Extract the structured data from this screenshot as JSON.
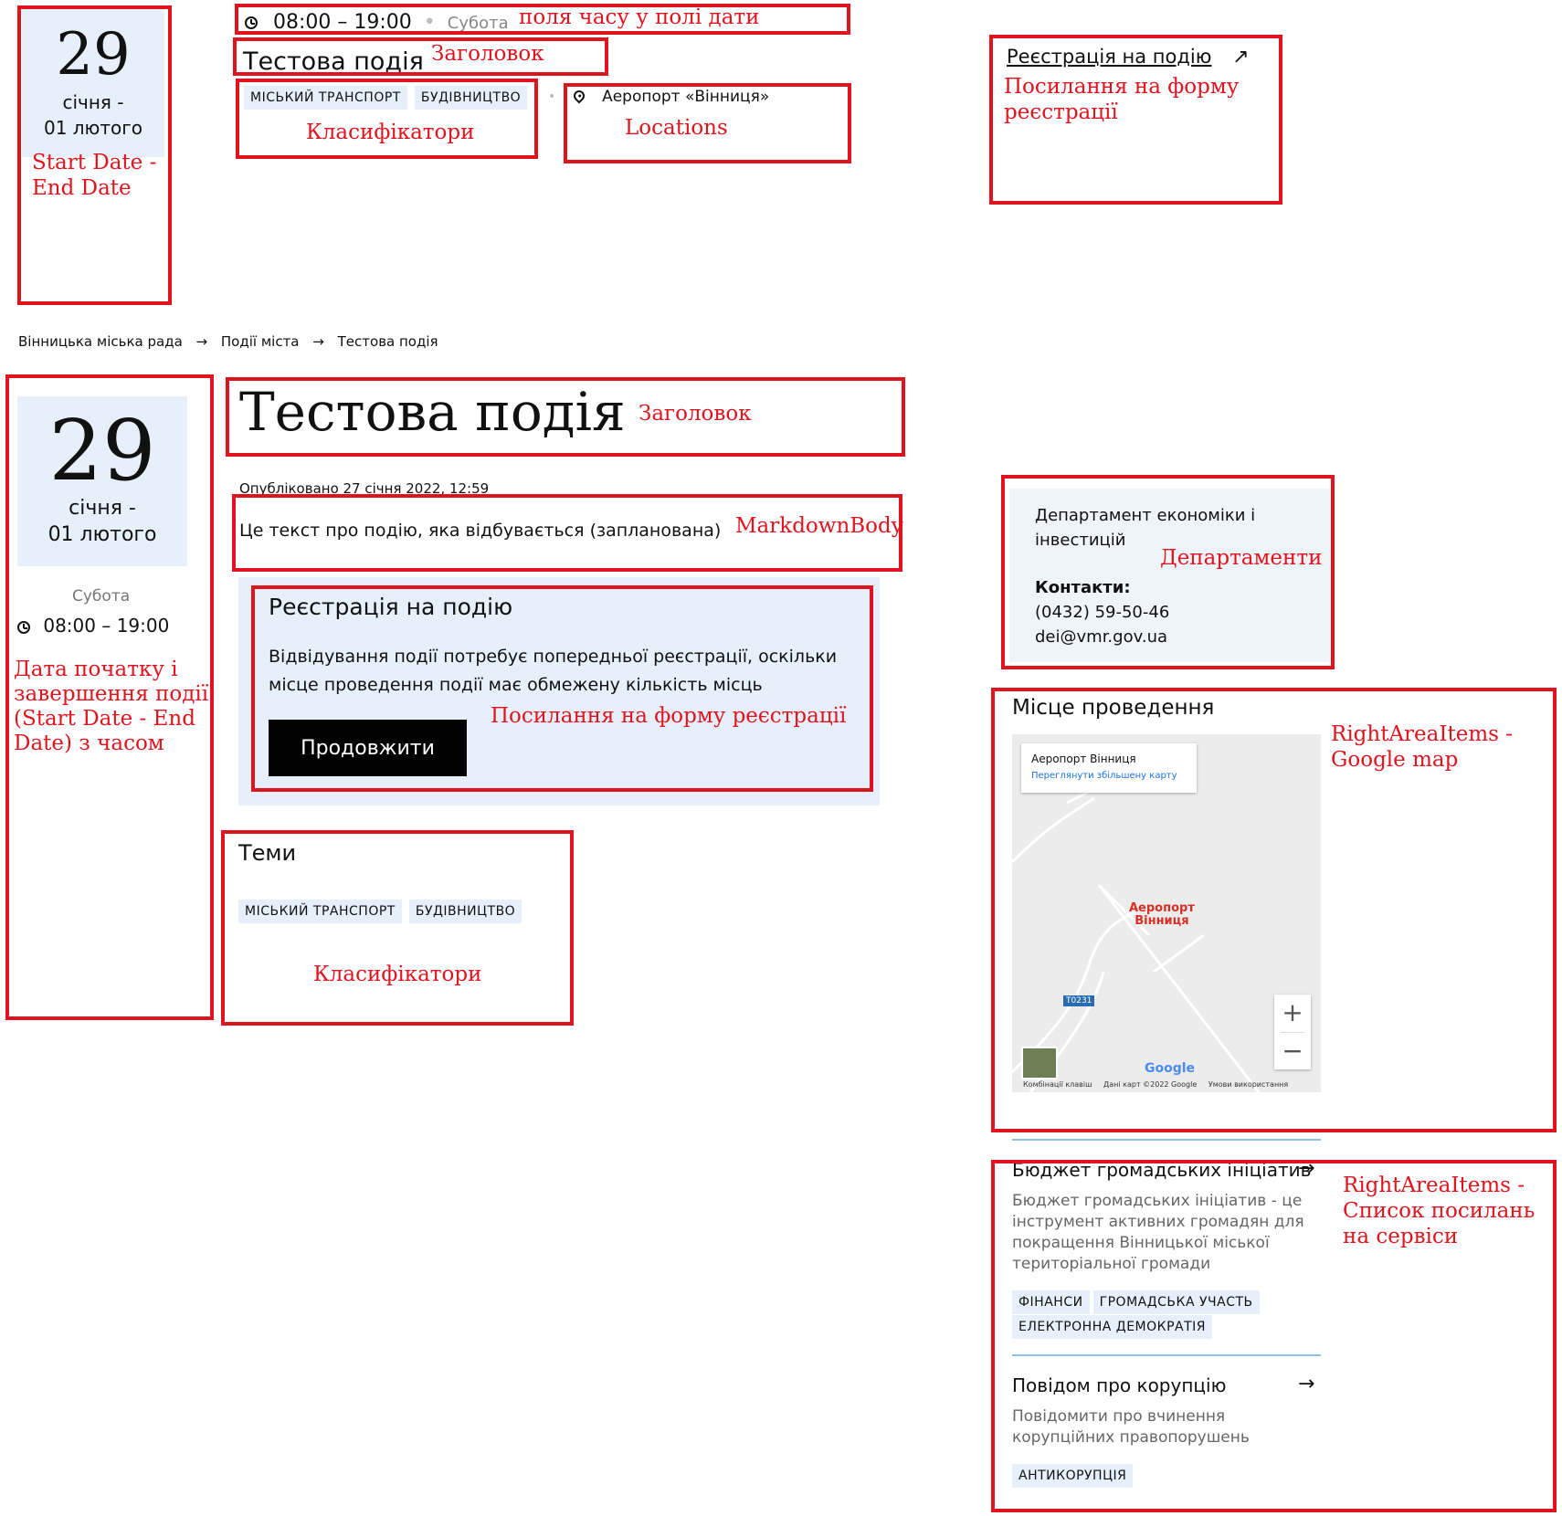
{
  "colors": {
    "annotation": "#e0141e",
    "calendar_bg": "#e7f0fa",
    "chip_bg": "#e7f0fa",
    "button_bg": "#000000",
    "map_link": "#1a73e8",
    "divider": "#8fc0e8"
  },
  "preview": {
    "start_day": "29",
    "date_range_line1": "січня -",
    "date_range_line2": "01 лютого",
    "time_range": "08:00 – 19:00",
    "weekday": "Субота",
    "title": "Тестова подія",
    "tags": [
      "МІСЬКИЙ ТРАНСПОРТ",
      "БУДІВНИЦТВО"
    ],
    "location": "Аеропорт «Вінниця»",
    "registration_link": "Реєстрація на подію",
    "arrow_icon": "arrow-up-right-icon"
  },
  "breadcrumb": [
    "Вінницька міська рада",
    "Події міста",
    "Тестова подія"
  ],
  "detail": {
    "start_day": "29",
    "date_range_line1": "січня -",
    "date_range_line2": "01 лютого",
    "weekday": "Субота",
    "time_range": "08:00 – 19:00",
    "title": "Тестова подія",
    "published": "Опубліковано 27 січня 2022, 12:59",
    "body": "Це текст про подію, яка відбувається (запланована)",
    "registration": {
      "heading": "Реєстрація на подію",
      "text_line1": "Відвідування події потребує попередньої реєстрації, оскільки",
      "text_line2": "місце проведення події має обмежену кількість місць",
      "button": "Продовжити"
    },
    "themes": {
      "heading": "Теми",
      "tags": [
        "МІСЬКИЙ ТРАНСПОРТ",
        "БУДІВНИЦТВО"
      ]
    }
  },
  "department": {
    "name_line1": "Департамент економіки і",
    "name_line2": "інвестицій",
    "contacts_label": "Контакти:",
    "phone": "(0432) 59-50-46",
    "email": "dei@vmr.gov.ua"
  },
  "venue": {
    "heading": "Місце проведення",
    "map": {
      "place_name": "Аеропорт Вінниця",
      "enlarge_link": "Переглянути збільшену карту",
      "marker_label_line1": "Аеропорт",
      "marker_label_line2": "Вінниця",
      "road_code": "T0231",
      "zoom_in": "+",
      "zoom_out": "−",
      "logo": "Google",
      "footer_shortcuts": "Комбінації клавіш",
      "footer_data": "Дані карт ©2022 Google",
      "footer_terms": "Умови використання"
    }
  },
  "services": [
    {
      "title": "Бюджет громадських ініціатив",
      "desc_lines": [
        "Бюджет громадських ініціатив - це",
        "інструмент активних громадян для",
        "покращення Вінницької міської",
        "територіальної громади"
      ],
      "tags_row1": [
        "ФІНАНСИ",
        "ГРОМАДСЬКА УЧАСТЬ"
      ],
      "tags_row2": [
        "ЕЛЕКТРОННА ДЕМОКРАТІЯ"
      ]
    },
    {
      "title": "Повідом про корупцію",
      "desc_lines": [
        "Повідомити про вчинення",
        "корупційних правопорушень"
      ],
      "tags_row1": [
        "АНТИКОРУПЦІЯ"
      ],
      "tags_row2": []
    }
  ],
  "annotations": {
    "time_fields": "поля часу у полі дати",
    "title": "Заголовок",
    "classifiers": "Класифікатори",
    "locations": "Locations",
    "start_end_line1": "Start Date -",
    "start_end_line2": "End Date",
    "reg_link_line1": "Посилання на форму",
    "reg_link_line2": "реєстрації",
    "title2": "Заголовок",
    "markdown": "MarkdownBody",
    "datetime_line1": "Дата початку і",
    "datetime_line2": "завершення події",
    "datetime_line3": "(Start Date - End",
    "datetime_line4": "Date) з часом",
    "reg_form_link": "Посилання на форму реєстрації",
    "classifiers2": "Класифікатори",
    "departments": "Департаменти",
    "right_map_line1": "RightAreaItems -",
    "right_map_line2": "Google map",
    "right_list_line1": "RightAreaItems -",
    "right_list_line2": "Список посилань",
    "right_list_line3": "на сервіси"
  }
}
